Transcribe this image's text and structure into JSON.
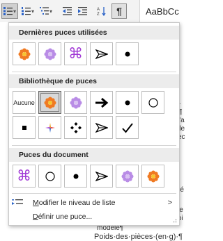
{
  "ribbon": {
    "style_preview": "AaBbCc",
    "buttons": [
      {
        "name": "bullets-button",
        "icon": "bullets-icon",
        "active": true
      },
      {
        "name": "numbering-button",
        "icon": "numbering-icon"
      },
      {
        "name": "multilevel-list-button",
        "icon": "multilevel-list-icon"
      },
      {
        "name": "decrease-indent-button",
        "icon": "decrease-indent-icon"
      },
      {
        "name": "increase-indent-button",
        "icon": "increase-indent-icon"
      },
      {
        "name": "sort-button",
        "icon": "sort-az-icon"
      },
      {
        "name": "show-marks-button",
        "icon": "pilcrow-icon"
      }
    ]
  },
  "document": {
    "fragments": [
      "¶",
      "é·",
      "l'a",
      "lle",
      "ec",
      "ré",
      "le",
      "oi"
    ],
    "line1": "modèle¶",
    "line2": "Poids·des·pièces·(en·g)·¶"
  },
  "panel": {
    "recent": {
      "title": "Dernières puces utilisées",
      "items": [
        "orange-flower-bullet",
        "purple-flower-bullet",
        "command-key-bullet",
        "arrowhead-bullet",
        "dot-bullet"
      ]
    },
    "library": {
      "title": "Bibliothèque de puces",
      "none_label": "Aucune",
      "items": [
        "none",
        "orange-flower-bullet",
        "purple-flower-bullet",
        "bold-arrow-bullet",
        "dot-bullet",
        "hollow-circle-bullet",
        "square-bullet",
        "colored-star-bullet",
        "diamond-cluster-bullet",
        "arrowhead-bullet",
        "checkmark-bullet"
      ],
      "selected": "orange-flower-bullet"
    },
    "document_bullets": {
      "title": "Puces du document",
      "items": [
        "command-key-bullet",
        "hollow-circle-bullet",
        "dot-bullet",
        "arrowhead-bullet",
        "purple-flower-bullet",
        "orange-flower-bullet"
      ]
    },
    "menu": {
      "change_level": "Modifier le niveau de liste",
      "change_level_accel": "M",
      "change_level_rest": "odifier le niveau de liste",
      "define_accel": "D",
      "define_rest": "éfinir une puce..."
    },
    "colors": {
      "orange": "#f07a22",
      "purple": "#b98ce6",
      "accent_blue": "#2b63c8"
    }
  }
}
